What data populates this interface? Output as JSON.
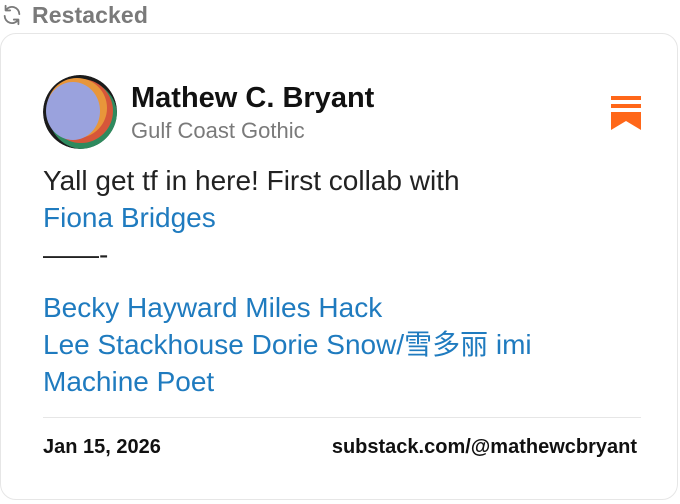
{
  "restack": {
    "icon": "restack-icon",
    "label": "Restacked"
  },
  "note": {
    "author": {
      "name": "Mathew C. Bryant",
      "publication": "Gulf Coast Gothic",
      "avatar_colors": [
        "#9aa2dd",
        "#e8963a",
        "#2f8a5e",
        "#d6563a",
        "#1b1b1b"
      ]
    },
    "bookmark_icon": "bookmark-icon",
    "body": {
      "line1_text": "Yall get tf in here! First collab with",
      "mention1": "Fiona Bridges",
      "separator": "——-",
      "mention_line1": "Becky Hayward Miles Hack",
      "mention_line2": "Lee Stackhouse Dorie Snow/雪多丽 imi",
      "mention_line3": "Machine Poet"
    },
    "footer": {
      "date": "Jan 15, 2026",
      "url": "substack.com/@mathewcbryant"
    }
  },
  "colors": {
    "link": "#1f7bbf",
    "accent": "#ff6719",
    "muted": "#7a7a7a"
  }
}
